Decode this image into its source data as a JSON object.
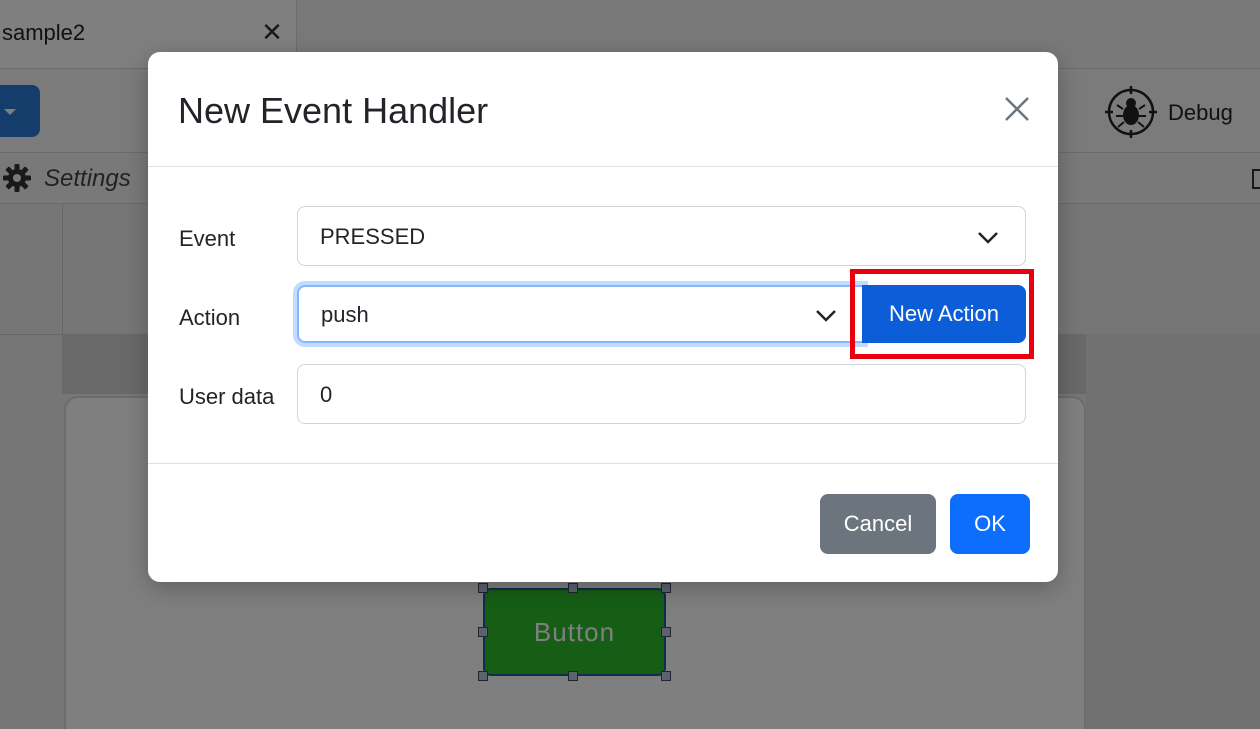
{
  "tab": {
    "title": "sample2",
    "close_icon": "close-icon"
  },
  "toolbar": {
    "debug_label": "Debug",
    "debug_icon": "bug-target-icon",
    "dropdown_icon": "caret-down-icon"
  },
  "settings": {
    "label": "Settings",
    "icon": "gear-icon"
  },
  "canvas": {
    "widget_label": "Button",
    "widget_color": "#2dbd2d"
  },
  "modal": {
    "title": "New Event Handler",
    "close_icon": "close-icon",
    "fields": {
      "event": {
        "label": "Event",
        "value": "PRESSED"
      },
      "action": {
        "label": "Action",
        "value": "push"
      },
      "user_data": {
        "label": "User data",
        "value": "0"
      }
    },
    "new_action_label": "New Action",
    "cancel_label": "Cancel",
    "ok_label": "OK"
  },
  "colors": {
    "primary": "#0d6efd",
    "primary_dark": "#0b5ed7",
    "secondary": "#6c757d",
    "highlight": "#e8000f"
  }
}
